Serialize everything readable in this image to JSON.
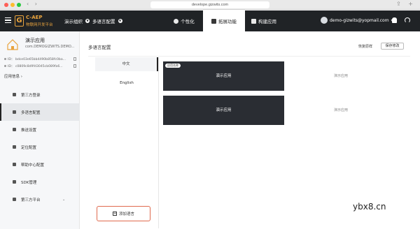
{
  "browser": {
    "url": "develope.gizwits.com"
  },
  "header": {
    "logo_mark": "G",
    "logo_title": "C-AEP",
    "logo_sub": "物联网开发平台",
    "breadcrumb": [
      "演示组织",
      "多语言配置"
    ],
    "tabs": [
      {
        "label": "个性化",
        "icon": "palette-icon"
      },
      {
        "label": "拓展功能",
        "icon": "expand-icon",
        "active": true
      },
      {
        "label": "构建应用",
        "icon": "build-icon"
      }
    ],
    "account": "demo-gizwits@yopmail.com"
  },
  "sidebar": {
    "app_name": "演示应用",
    "app_sub": "com.DEMOGIZWITS.DEMO...",
    "ids": [
      "ID：  bdce03e65bb4490b858fc0ba...",
      "ID：  c0809c8d9fd3045cb089fa6..."
    ],
    "app_info": "应用信息",
    "nav": [
      {
        "label": "第三方登录",
        "icon": "key-icon"
      },
      {
        "label": "多语言配置",
        "icon": "translate-icon",
        "active": true
      },
      {
        "label": "推送设置",
        "icon": "send-icon"
      },
      {
        "label": "定位配置",
        "icon": "location-icon"
      },
      {
        "label": "帮助中心配置",
        "icon": "help-icon"
      },
      {
        "label": "SDK管理",
        "icon": "phone-icon"
      },
      {
        "label": "第三方平台",
        "icon": "platform-icon",
        "chevron": true
      }
    ]
  },
  "main": {
    "title": "多语言配置",
    "reset": "恢复原样",
    "save": "保存修改",
    "languages": [
      "中文",
      "English"
    ],
    "add_language": "添加语言",
    "cards": [
      {
        "badge": "应用名称",
        "text": "演示应用",
        "side": "演示应用"
      },
      {
        "text": "演示应用",
        "side": "演示应用"
      }
    ]
  },
  "watermark": "ybx8.cn"
}
